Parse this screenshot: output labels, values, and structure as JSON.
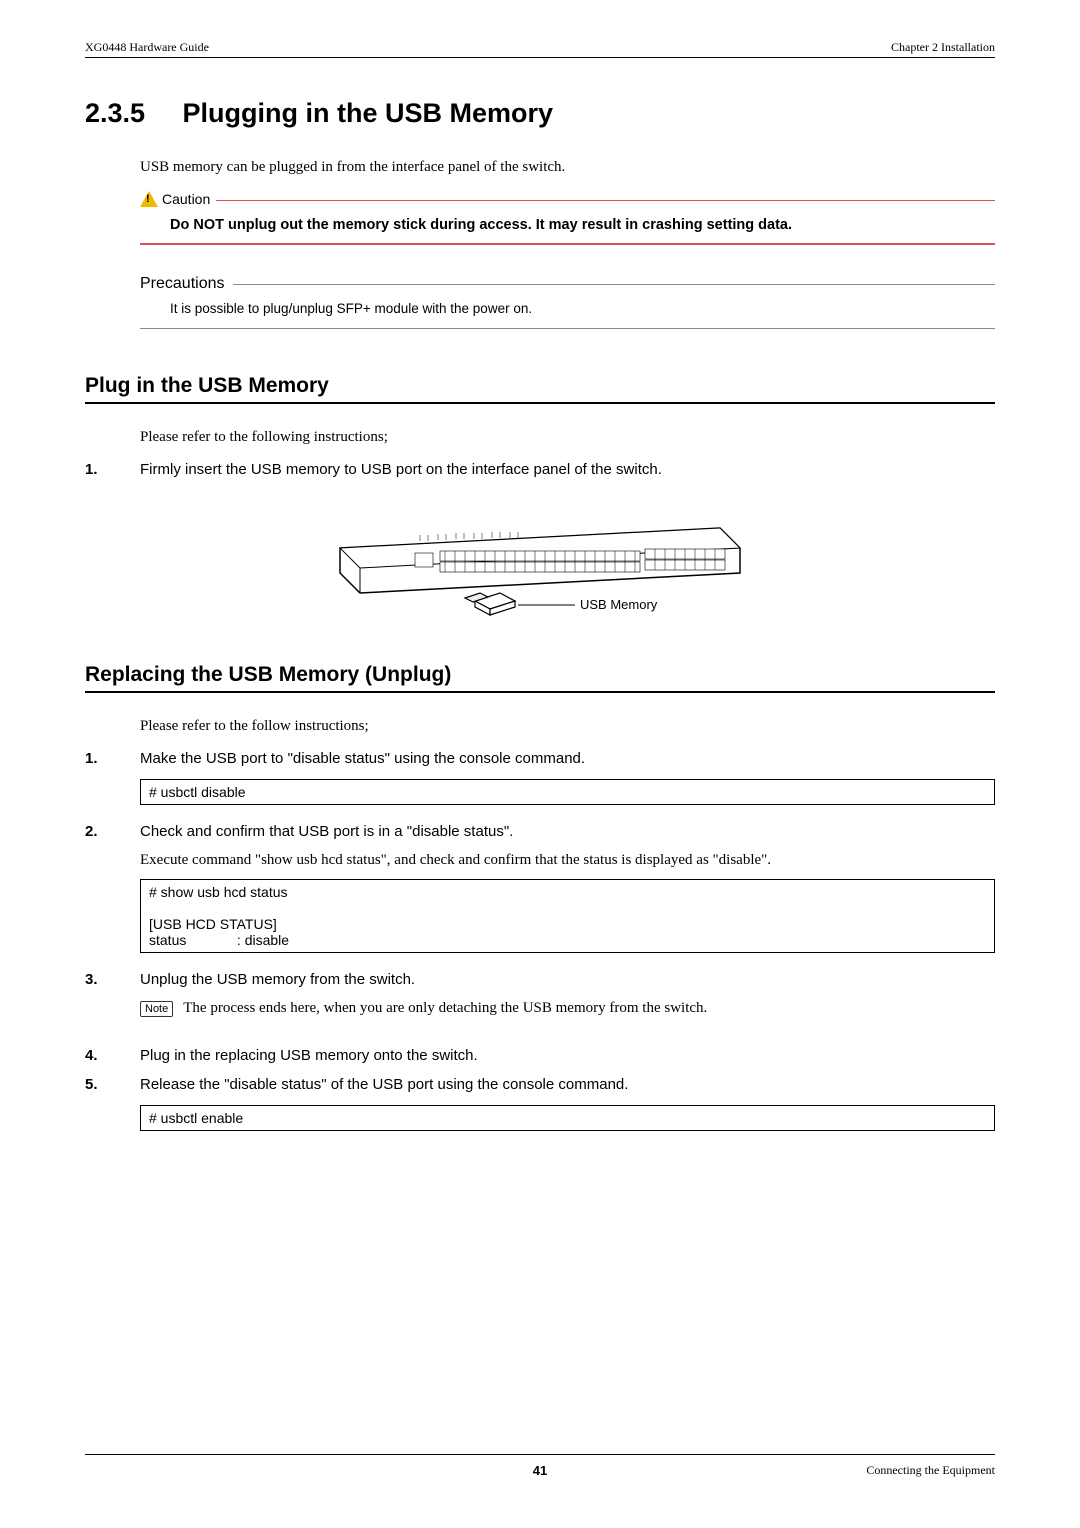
{
  "header": {
    "left": "XG0448 Hardware Guide",
    "right": "Chapter 2 Installation"
  },
  "section": {
    "number": "2.3.5",
    "title": "Plugging in the USB Memory",
    "intro": "USB memory can be plugged in from the interface panel of the switch."
  },
  "caution": {
    "label": "Caution",
    "text": "Do NOT unplug out the memory stick during access. It may result in crashing setting data."
  },
  "precautions": {
    "label": "Precautions",
    "text": "It is possible to plug/unplug SFP+ module with the power on."
  },
  "sub1": {
    "title": "Plug in the USB Memory",
    "intro": "Please refer to the following instructions;",
    "step1_num": "1.",
    "step1_text": "Firmly insert the USB memory to USB port on the interface panel of the switch.",
    "figure_label": "USB Memory"
  },
  "sub2": {
    "title": "Replacing the USB Memory (Unplug)",
    "intro": "Please refer to the follow instructions;",
    "step1_num": "1.",
    "step1_text": "Make the USB port to \"disable status\" using the console command.",
    "code1": "# usbctl disable",
    "step2_num": "2.",
    "step2_text": "Check and confirm that USB port is in a \"disable status\".",
    "step2_sub": "Execute command \"show usb hcd status\", and check and confirm that the status is displayed as \"disable\".",
    "code2": "# show usb hcd status\n\n[USB HCD STATUS]\nstatus             : disable",
    "step3_num": "3.",
    "step3_text": "Unplug the USB memory from the switch.",
    "note_label": "Note",
    "note_text": "The process ends here, when you are only detaching the USB memory from the switch.",
    "step4_num": "4.",
    "step4_text": "Plug in the replacing USB memory onto the switch.",
    "step5_num": "5.",
    "step5_text": "Release the \"disable status\" of the USB port using the console command.",
    "code3": "# usbctl enable"
  },
  "footer": {
    "page": "41",
    "right": "Connecting the Equipment"
  }
}
